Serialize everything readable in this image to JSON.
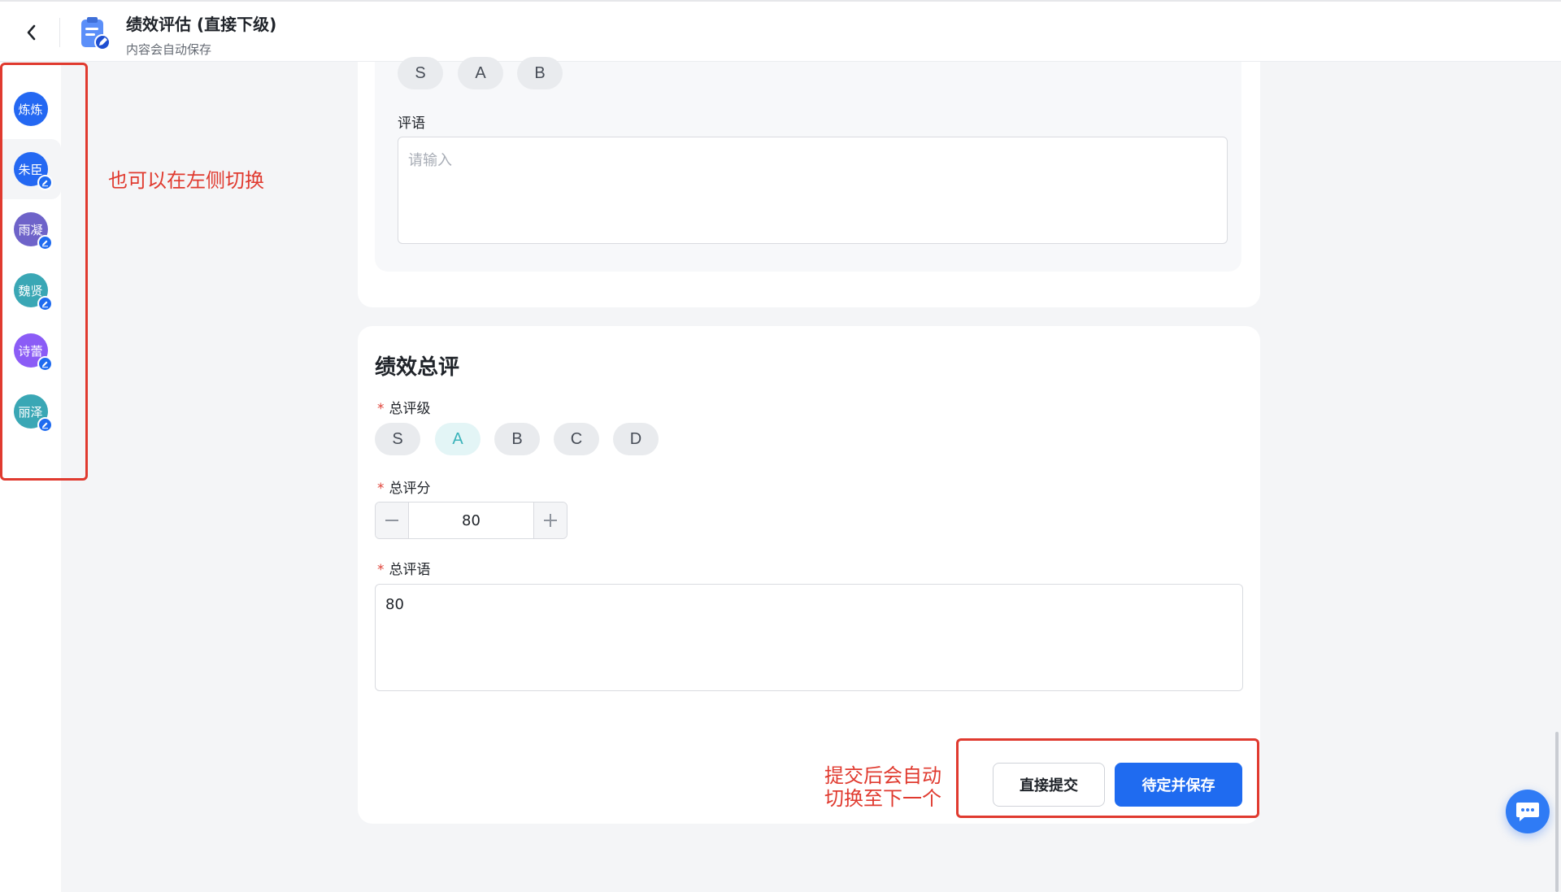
{
  "header": {
    "title": "绩效评估 (直接下级)",
    "subtitle": "内容会自动保存"
  },
  "sidebar": {
    "avatars": [
      {
        "label": "炼炼",
        "color": "#2468f2",
        "editable": false,
        "active": false
      },
      {
        "label": "朱臣",
        "color": "#2468f2",
        "editable": true,
        "active": true
      },
      {
        "label": "雨凝",
        "color": "#6e63c9",
        "editable": true,
        "active": false
      },
      {
        "label": "魏贤",
        "color": "#3aa7b5",
        "editable": true,
        "active": false
      },
      {
        "label": "诗蕾",
        "color": "#8b5cf6",
        "editable": true,
        "active": false
      },
      {
        "label": "丽泽",
        "color": "#3aa7b5",
        "editable": true,
        "active": false
      }
    ]
  },
  "annotations": {
    "left": "也可以在左侧切换",
    "right_line1": "提交后会自动",
    "right_line2": "切换至下一个"
  },
  "previous_section": {
    "grades": [
      "S",
      "A",
      "B"
    ],
    "comment_label": "评语",
    "comment_placeholder": "请输入"
  },
  "summary": {
    "title": "绩效总评",
    "grade_label": "总评级",
    "grades": [
      "S",
      "A",
      "B",
      "C",
      "D"
    ],
    "selected_grade": "A",
    "score_label": "总评分",
    "score_value": "80",
    "comment_label": "总评语",
    "comment_value": "80",
    "required_mark": "*"
  },
  "actions": {
    "submit_label": "直接提交",
    "save_label": "待定并保存"
  },
  "colors": {
    "primary": "#1f6bf0",
    "annotation": "#e03a2f",
    "selected_grade": "#3ab3ba"
  }
}
